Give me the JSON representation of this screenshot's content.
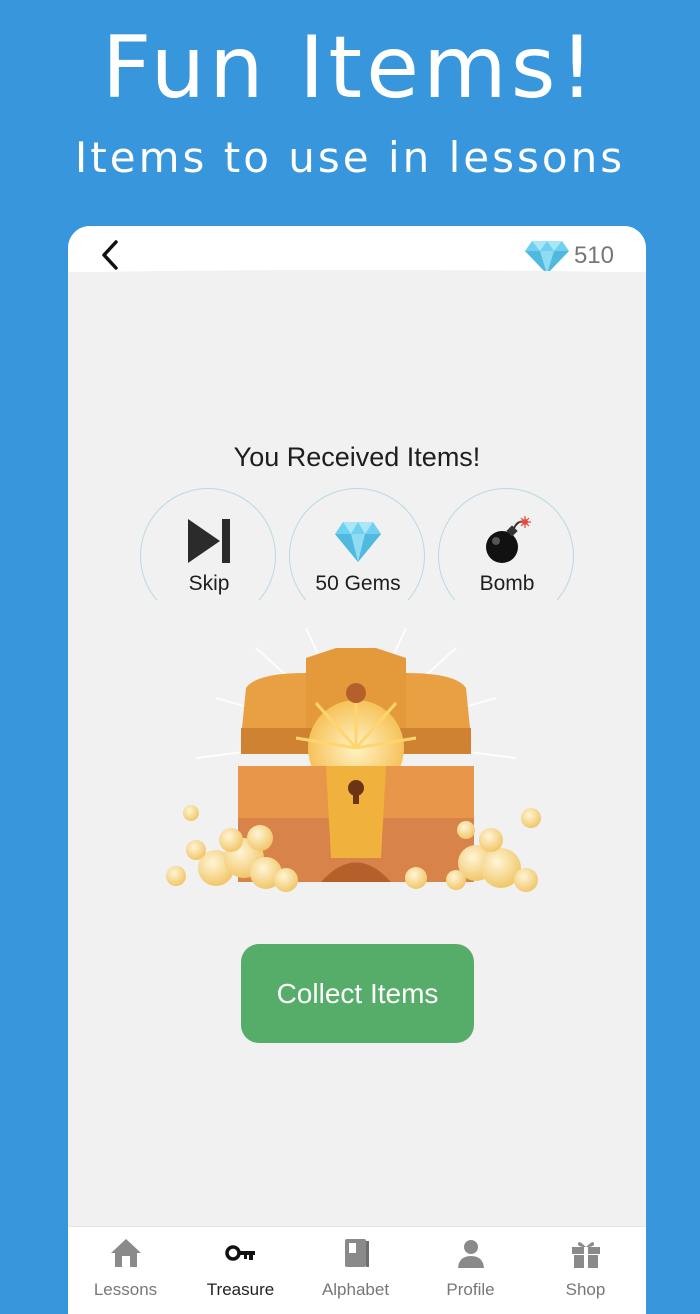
{
  "promo": {
    "title": "Fun Items!",
    "subtitle": "Items to use in lessons"
  },
  "header": {
    "back_icon": "back-chevron-icon",
    "gem_icon": "diamond-icon",
    "gem_count": "510"
  },
  "reward": {
    "title": "You Received Items!",
    "items": [
      {
        "label": "Skip",
        "icon": "skip-icon"
      },
      {
        "label": "50 Gems",
        "icon": "diamond-icon"
      },
      {
        "label": "Bomb",
        "icon": "bomb-icon"
      }
    ],
    "illustration": "treasure-chest-icon",
    "collect_label": "Collect Items"
  },
  "nav": {
    "items": [
      {
        "label": "Lessons",
        "icon": "home-icon",
        "active": false
      },
      {
        "label": "Treasure",
        "icon": "key-icon",
        "active": true
      },
      {
        "label": "Alphabet",
        "icon": "book-icon",
        "active": false
      },
      {
        "label": "Profile",
        "icon": "person-icon",
        "active": false
      },
      {
        "label": "Shop",
        "icon": "gift-icon",
        "active": false
      }
    ]
  },
  "colors": {
    "background": "#3796dc",
    "accent_green": "#55ad69",
    "gem_blue": "#6fd0ef",
    "nav_inactive": "#777777"
  }
}
